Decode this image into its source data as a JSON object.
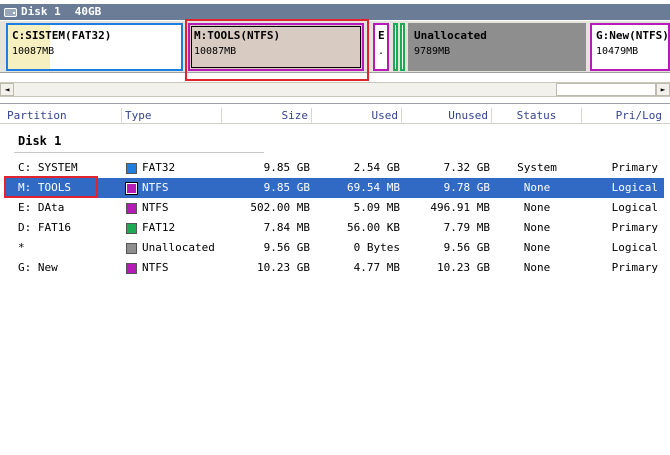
{
  "disk_header": {
    "title": "Disk 1",
    "capacity": "40GB"
  },
  "disk_map": {
    "c": {
      "label": "C:SISTEM(FAT32)",
      "size": "10087MB"
    },
    "m": {
      "label": "M:TOOLS(NTFS)",
      "size": "10087MB"
    },
    "e": {
      "label": "E",
      "size": "."
    },
    "u": {
      "label": "Unallocated",
      "size": "9789MB"
    },
    "g": {
      "label": "G:New(NTFS)",
      "size": "10479MB"
    }
  },
  "scrollbar": {
    "left": "◄",
    "right": "►"
  },
  "columns": {
    "partition": "Partition",
    "type": "Type",
    "size": "Size",
    "used": "Used",
    "unused": "Unused",
    "status": "Status",
    "prilog": "Pri/Log"
  },
  "disk_label": "Disk 1",
  "rows": [
    {
      "partition": "C: SYSTEM",
      "type": "FAT32",
      "color": "#1f7ee0",
      "size": "9.85 GB",
      "used": "2.54 GB",
      "unused": "7.32 GB",
      "status": "System",
      "prilog": "Primary"
    },
    {
      "partition": "M: TOOLS",
      "type": "NTFS",
      "color": "#b71bb7",
      "size": "9.85 GB",
      "used": "69.54 MB",
      "unused": "9.78 GB",
      "status": "None",
      "prilog": "Logical"
    },
    {
      "partition": "E: DAta",
      "type": "NTFS",
      "color": "#b71bb7",
      "size": "502.00 MB",
      "used": "5.09 MB",
      "unused": "496.91 MB",
      "status": "None",
      "prilog": "Logical"
    },
    {
      "partition": "D: FAT16",
      "type": "FAT12",
      "color": "#1cab53",
      "size": "7.84 MB",
      "used": "56.00 KB",
      "unused": "7.79 MB",
      "status": "None",
      "prilog": "Primary"
    },
    {
      "partition": "*",
      "type": "Unallocated",
      "color": "#8e8e8e",
      "size": "9.56 GB",
      "used": "0 Bytes",
      "unused": "9.56 GB",
      "status": "None",
      "prilog": "Logical"
    },
    {
      "partition": "G: New",
      "type": "NTFS",
      "color": "#b71bb7",
      "size": "10.23 GB",
      "used": "4.77 MB",
      "unused": "10.23 GB",
      "status": "None",
      "prilog": "Primary"
    }
  ],
  "selected_row": 1,
  "colors": {
    "selection": "#316ac5",
    "highlight": "#e0232f",
    "header_bar": "#6b7d96"
  }
}
